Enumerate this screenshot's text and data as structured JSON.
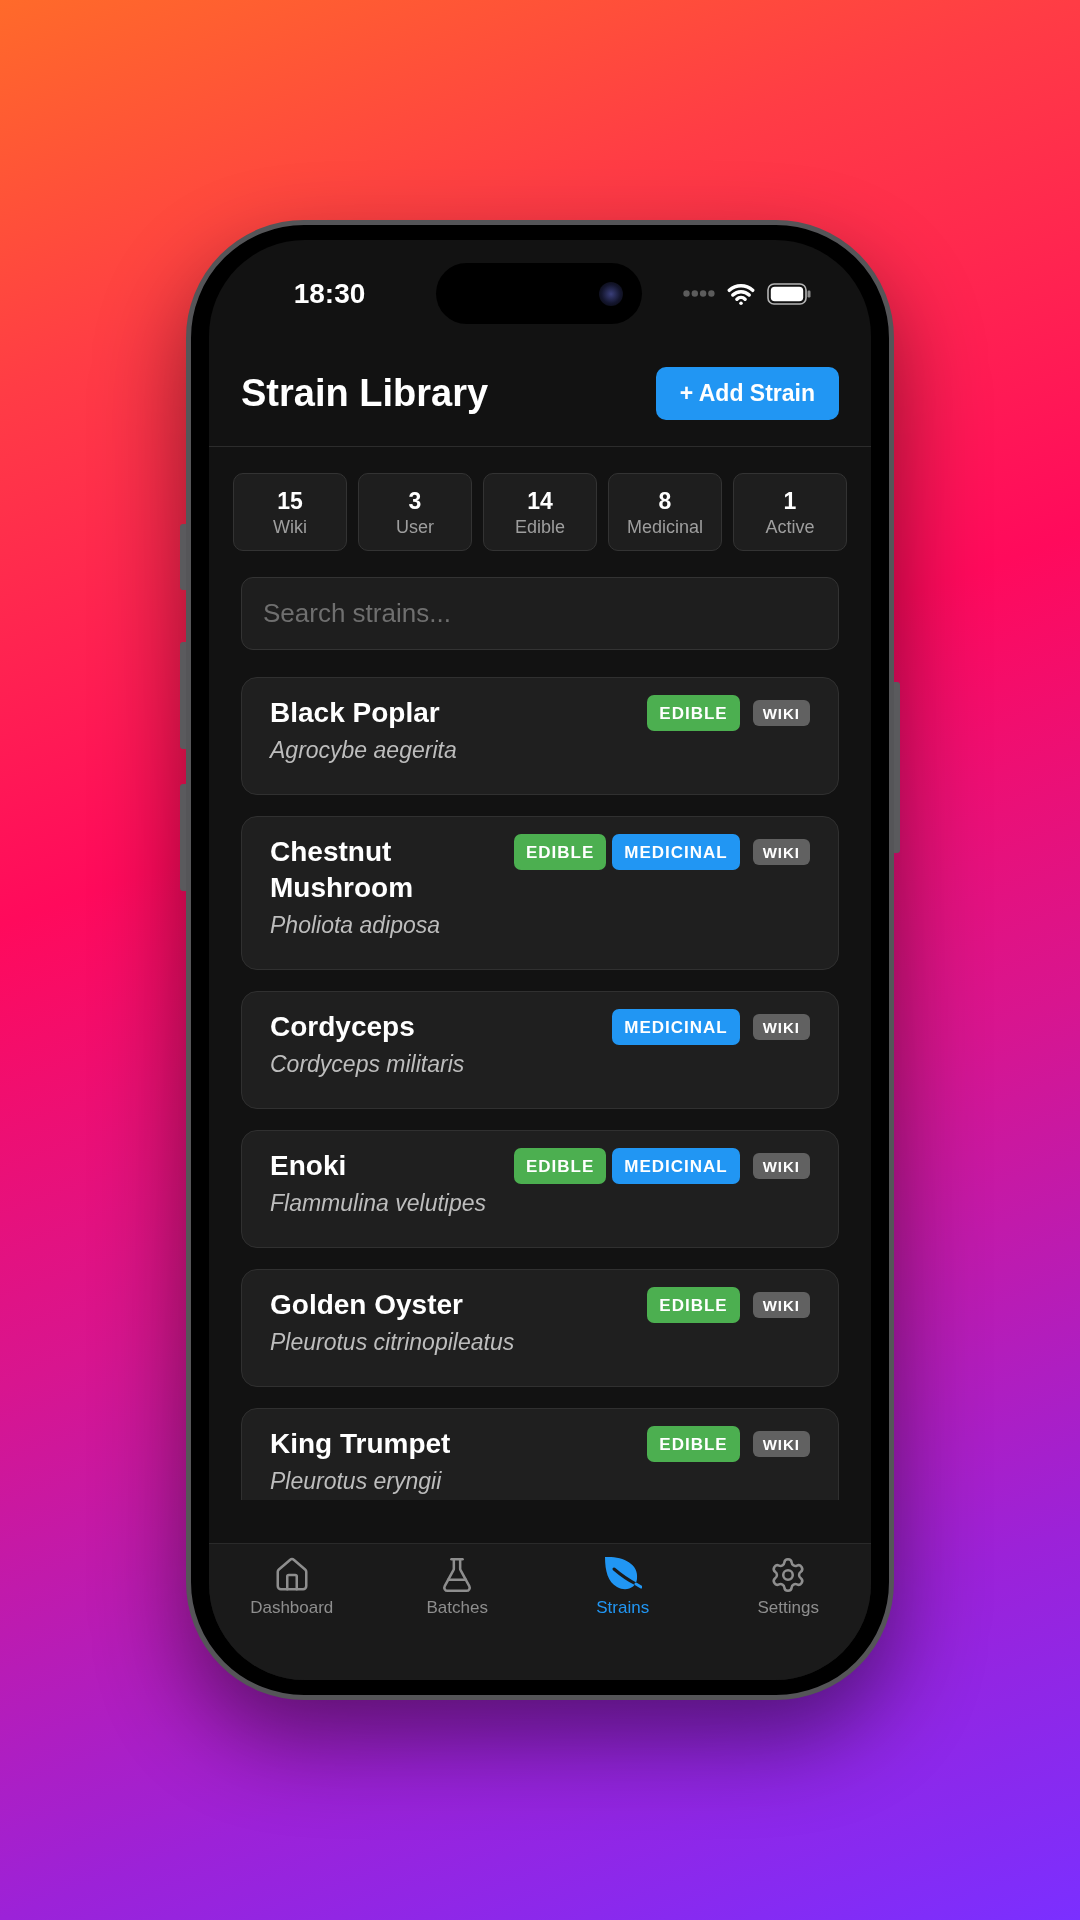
{
  "status_bar": {
    "time": "18:30"
  },
  "header": {
    "title": "Strain Library",
    "add_button": "+ Add Strain"
  },
  "stats": [
    {
      "value": "15",
      "label": "Wiki"
    },
    {
      "value": "3",
      "label": "User"
    },
    {
      "value": "14",
      "label": "Edible"
    },
    {
      "value": "8",
      "label": "Medicinal"
    },
    {
      "value": "1",
      "label": "Active"
    }
  ],
  "search": {
    "placeholder": "Search strains..."
  },
  "strains": [
    {
      "name": "Black Poplar",
      "scientific_name": "Agrocybe aegerita",
      "tags": [
        {
          "kind": "edible",
          "label": "EDIBLE"
        },
        {
          "kind": "wiki",
          "label": "WIKI"
        }
      ]
    },
    {
      "name": "Chestnut Mushroom",
      "scientific_name": "Pholiota adiposa",
      "tags": [
        {
          "kind": "edible",
          "label": "EDIBLE"
        },
        {
          "kind": "medicinal",
          "label": "MEDICINAL"
        },
        {
          "kind": "wiki",
          "label": "WIKI"
        }
      ]
    },
    {
      "name": "Cordyceps",
      "scientific_name": "Cordyceps militaris",
      "tags": [
        {
          "kind": "medicinal",
          "label": "MEDICINAL"
        },
        {
          "kind": "wiki",
          "label": "WIKI"
        }
      ]
    },
    {
      "name": "Enoki",
      "scientific_name": "Flammulina velutipes",
      "tags": [
        {
          "kind": "edible",
          "label": "EDIBLE"
        },
        {
          "kind": "medicinal",
          "label": "MEDICINAL"
        },
        {
          "kind": "wiki",
          "label": "WIKI"
        }
      ]
    },
    {
      "name": "Golden Oyster",
      "scientific_name": "Pleurotus citrinopileatus",
      "tags": [
        {
          "kind": "edible",
          "label": "EDIBLE"
        },
        {
          "kind": "wiki",
          "label": "WIKI"
        }
      ]
    },
    {
      "name": "King Trumpet",
      "scientific_name": "Pleurotus eryngii",
      "tags": [
        {
          "kind": "edible",
          "label": "EDIBLE"
        },
        {
          "kind": "wiki",
          "label": "WIKI"
        }
      ]
    }
  ],
  "tab_bar": [
    {
      "label": "Dashboard",
      "selected": false
    },
    {
      "label": "Batches",
      "selected": false
    },
    {
      "label": "Strains",
      "selected": true
    },
    {
      "label": "Settings",
      "selected": false
    }
  ]
}
